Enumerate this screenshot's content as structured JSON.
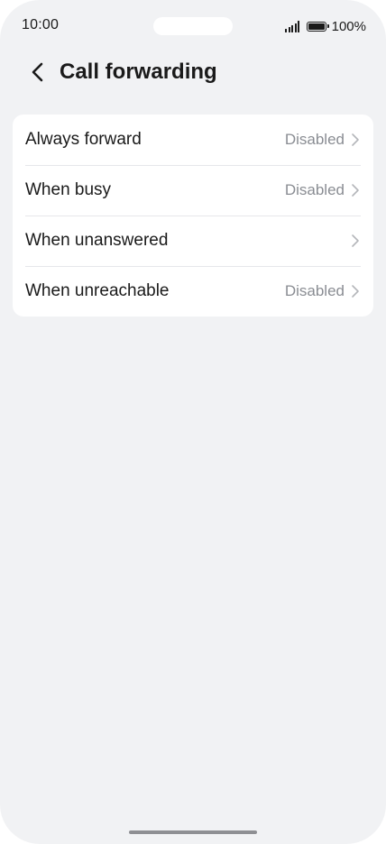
{
  "status_bar": {
    "time": "10:00",
    "battery_text": "100%",
    "signal_icon": "signal-icon",
    "battery_icon": "battery-icon"
  },
  "header": {
    "title": "Call forwarding",
    "back_icon": "chevron-left-icon"
  },
  "settings": {
    "items": [
      {
        "label": "Always forward",
        "value": "Disabled"
      },
      {
        "label": "When busy",
        "value": "Disabled"
      },
      {
        "label": "When unanswered",
        "value": ""
      },
      {
        "label": "When unreachable",
        "value": "Disabled"
      }
    ],
    "chevron_icon": "chevron-right-icon"
  },
  "colors": {
    "background": "#f1f2f4",
    "card": "#ffffff",
    "text_primary": "#1a1a1a",
    "text_secondary": "#8a8d93",
    "divider": "#e6e7ea"
  }
}
